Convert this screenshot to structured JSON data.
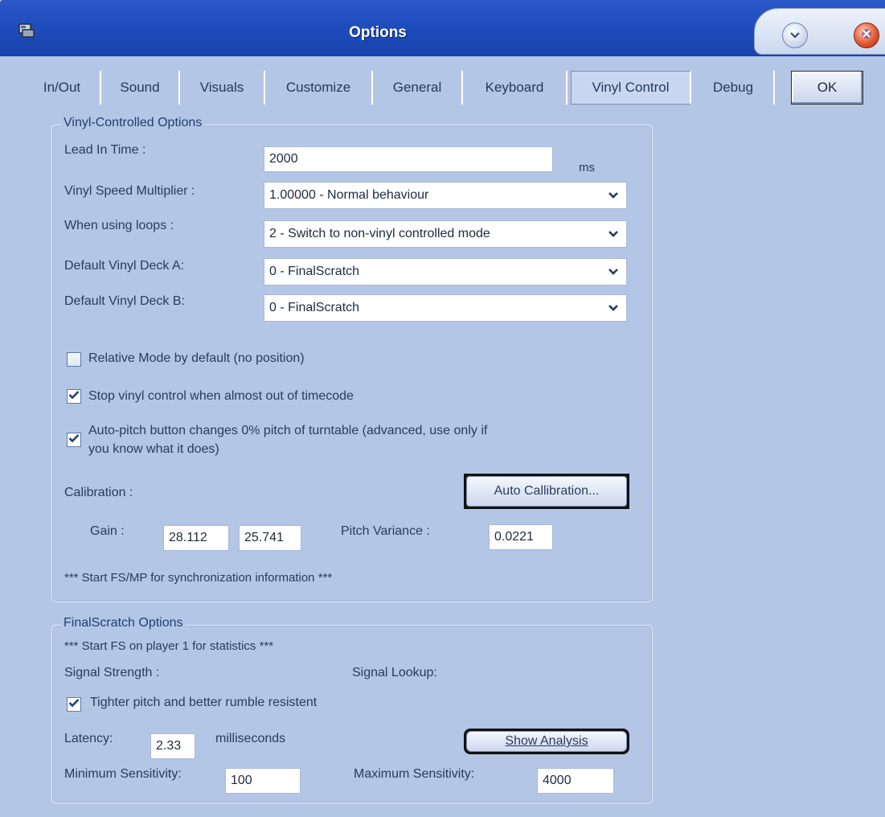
{
  "window": {
    "title": "Options"
  },
  "tabs": [
    {
      "label": "In/Out"
    },
    {
      "label": "Sound"
    },
    {
      "label": "Visuals"
    },
    {
      "label": "Customize"
    },
    {
      "label": "General"
    },
    {
      "label": "Keyboard"
    },
    {
      "label": "Vinyl Control",
      "active": true
    },
    {
      "label": "Debug"
    }
  ],
  "ok_label": "OK",
  "vinyl": {
    "legend": "Vinyl-Controlled Options",
    "lead_in_label": "Lead In Time :",
    "lead_in_value": "2000",
    "lead_in_unit": "ms",
    "speed_label": "Vinyl Speed Multiplier :",
    "speed_value": "1.00000 - Normal behaviour",
    "loops_label": "When using loops :",
    "loops_value": "2 - Switch to non-vinyl controlled mode",
    "deck_a_label": "Default Vinyl Deck A:",
    "deck_a_value": "0 - FinalScratch",
    "deck_b_label": "Default Vinyl Deck B:",
    "deck_b_value": "0 - FinalScratch",
    "relative_label": "Relative Mode by default (no position)",
    "relative_checked": false,
    "stop_label": "Stop vinyl control when almost out of timecode",
    "stop_checked": true,
    "autopitch_label_1": "Auto-pitch button changes 0% pitch of turntable (advanced, use only if",
    "autopitch_label_2": "you know what it does)",
    "autopitch_checked": true,
    "calibration_label": "Calibration :",
    "auto_calibration_button": "Auto Callibration...",
    "gain_label": "Gain :",
    "gain_1": "28.112",
    "gain_2": "25.741",
    "pitch_variance_label": "Pitch Variance :",
    "pitch_variance_value": "0.0221",
    "sync_info": "*** Start FS/MP for synchronization information ***"
  },
  "finalscratch": {
    "legend": "FinalScratch Options",
    "stats_info": "*** Start FS on player 1 for statistics ***",
    "signal_strength_label": "Signal Strength :",
    "signal_lookup_label": "Signal Lookup:",
    "tighter_label": "Tighter pitch and better rumble resistent",
    "tighter_checked": true,
    "latency_label": "Latency:",
    "latency_value": "2.33",
    "latency_unit": "milliseconds",
    "show_analysis_button": "Show Analysis",
    "min_sens_label": "Minimum Sensitivity:",
    "min_sens_value": "100",
    "max_sens_label": "Maximum Sensitivity:",
    "max_sens_value": "4000"
  },
  "colors": {
    "background": "#b4c6e6",
    "titlebar": "#1f4dbd",
    "text": "#2a3c5e",
    "legend_text": "#22406e"
  },
  "icons": [
    "app-icon",
    "minimize-icon",
    "close-icon",
    "chevron-down-icon",
    "checkmark-icon"
  ]
}
